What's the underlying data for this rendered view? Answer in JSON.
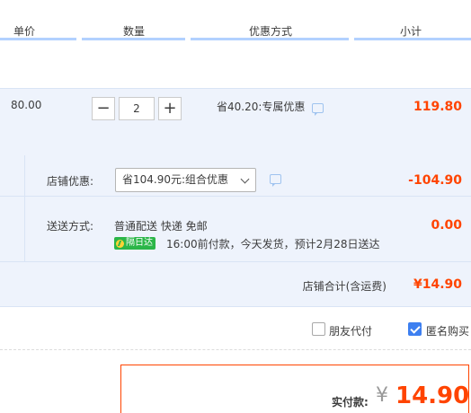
{
  "header": {
    "col_price": "单价",
    "col_qty": "数量",
    "col_promo": "优惠方式",
    "col_subtotal": "小计"
  },
  "item": {
    "unit_price": "80.00",
    "quantity": "2",
    "minus": "−",
    "plus": "+",
    "promo_text": "省40.20:专属优惠",
    "subtotal": "119.80"
  },
  "shop": {
    "discount_label": "店铺优惠:",
    "discount_option": "省104.90元:组合优惠",
    "discount_value": "-104.90",
    "shipping_label": "送送方式:",
    "shipping_method": "普通配送 快递 免邮",
    "shipping_badge": "隔日达",
    "shipping_note": "16:00前付款，今天发货，预计2月28日送达",
    "shipping_fee": "0.00",
    "total_label": "店铺合计(含运费)",
    "total_value": "¥14.90"
  },
  "options": {
    "friend_pay_label": "朋友代付",
    "friend_pay_checked": false,
    "anonymous_label": "匿名购买",
    "anonymous_checked": true
  },
  "payment": {
    "label": "实付款:",
    "currency": "¥",
    "amount": "14.90"
  },
  "colors": {
    "accent_price": "#ff4400",
    "header_bar": "#b2d1ff",
    "row_bg": "#eef3fc",
    "checkbox_blue": "#3d7ff0",
    "badge_green": "#2bb648"
  }
}
